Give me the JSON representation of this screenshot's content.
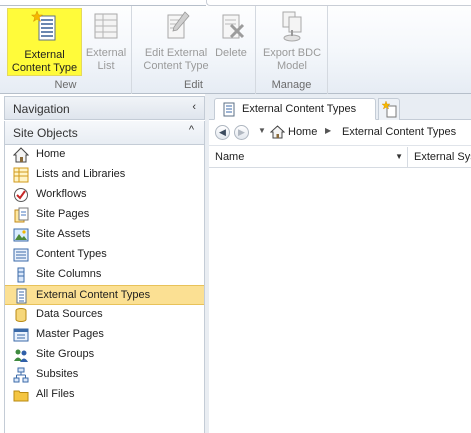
{
  "ribbon": {
    "groups": [
      {
        "label": "New",
        "buttons": [
          {
            "line1": "External",
            "line2": "Content Type",
            "icon": "external-content-type-icon",
            "active": true
          },
          {
            "line1": "External",
            "line2": "List",
            "icon": "external-list-icon",
            "active": false
          }
        ]
      },
      {
        "label": "Edit",
        "buttons": [
          {
            "line1": "Edit External",
            "line2": "Content Type",
            "icon": "edit-icon",
            "active": false
          },
          {
            "line1": "Delete",
            "line2": "",
            "icon": "delete-icon",
            "active": false
          }
        ]
      },
      {
        "label": "Manage",
        "buttons": [
          {
            "line1": "Export BDC",
            "line2": "Model",
            "icon": "export-icon",
            "active": false
          }
        ]
      }
    ]
  },
  "navigation": {
    "title": "Navigation",
    "collapse_glyph": "‹",
    "section_title": "Site Objects",
    "section_glyph": "^",
    "items": [
      {
        "label": "Home",
        "icon": "home-icon",
        "selected": false
      },
      {
        "label": "Lists and Libraries",
        "icon": "lists-icon",
        "selected": false
      },
      {
        "label": "Workflows",
        "icon": "workflow-icon",
        "selected": false
      },
      {
        "label": "Site Pages",
        "icon": "site-pages-icon",
        "selected": false
      },
      {
        "label": "Site Assets",
        "icon": "site-assets-icon",
        "selected": false
      },
      {
        "label": "Content Types",
        "icon": "content-types-icon",
        "selected": false
      },
      {
        "label": "Site Columns",
        "icon": "site-columns-icon",
        "selected": false
      },
      {
        "label": "External Content Types",
        "icon": "external-content-types-icon",
        "selected": true
      },
      {
        "label": "Data Sources",
        "icon": "data-sources-icon",
        "selected": false
      },
      {
        "label": "Master Pages",
        "icon": "master-pages-icon",
        "selected": false
      },
      {
        "label": "Site Groups",
        "icon": "site-groups-icon",
        "selected": false
      },
      {
        "label": "Subsites",
        "icon": "subsites-icon",
        "selected": false
      },
      {
        "label": "All Files",
        "icon": "folder-icon",
        "selected": false
      }
    ]
  },
  "tabs": {
    "active_label": "External Content Types"
  },
  "breadcrumb": {
    "back": "◀",
    "forward": "▶",
    "home": "Home",
    "current": "External Content Types"
  },
  "table": {
    "columns": [
      "Name",
      "External Sys"
    ]
  },
  "colors": {
    "active_button": "#fffb3a",
    "selected_item": "#fbe093"
  }
}
